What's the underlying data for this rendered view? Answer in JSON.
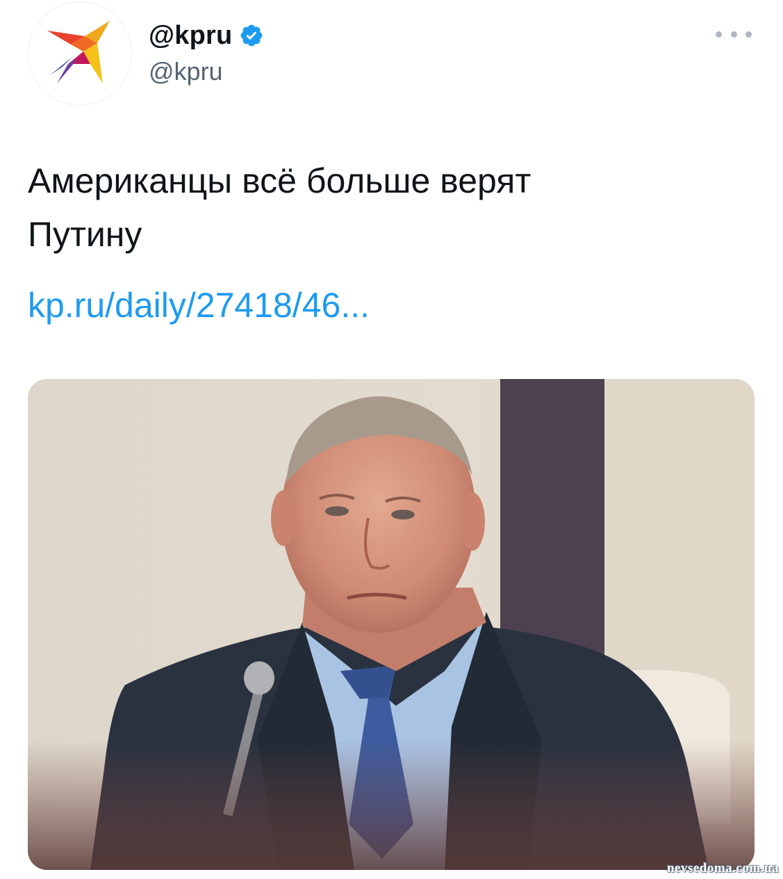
{
  "tweet": {
    "display_name": "@kpru",
    "handle": "@kpru",
    "verified": true,
    "text_lines": [
      "Американцы всё больше верят",
      "Путину"
    ],
    "link": "kp.ru/daily/27418/46...",
    "avatar_icon": "kp-logo-bird-icon",
    "more_icon": "more-options-icon"
  },
  "media": {
    "image_icon": "photo-man-in-suit-icon"
  },
  "watermark": "nevsedoma.com.ua",
  "colors": {
    "link": "#1d9bf0",
    "verified": "#1d9bf0",
    "handle": "#536471",
    "text": "#0f1419"
  }
}
